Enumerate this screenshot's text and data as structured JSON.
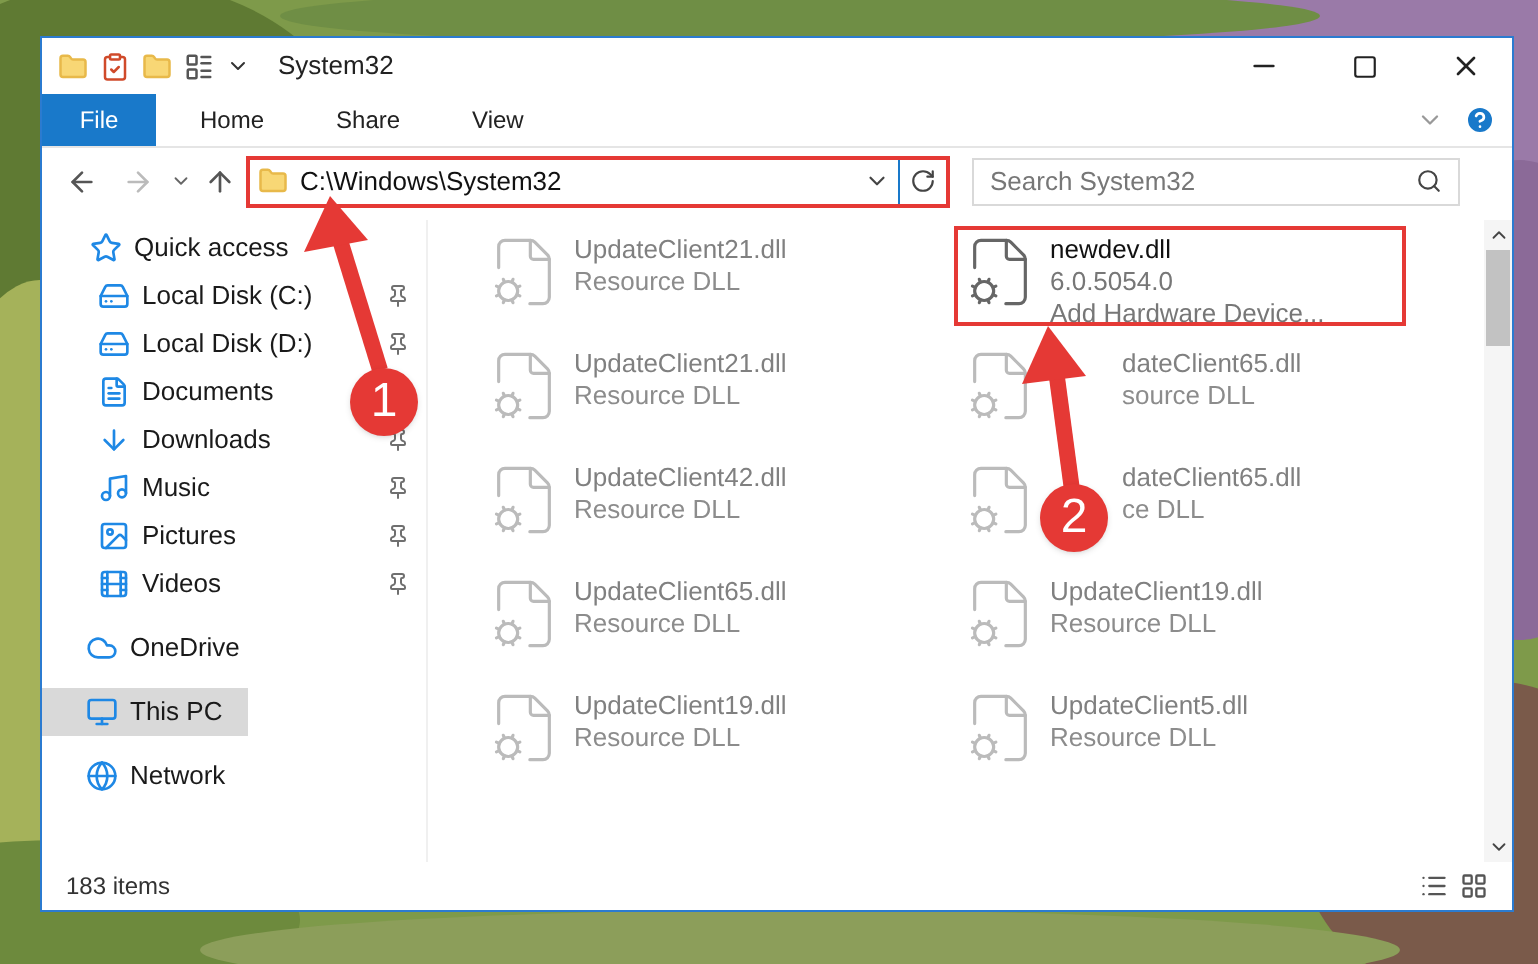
{
  "window": {
    "title": "System32"
  },
  "ribbon_tabs": [
    {
      "label": "File",
      "selected": true
    },
    {
      "label": "Home",
      "selected": false
    },
    {
      "label": "Share",
      "selected": false
    },
    {
      "label": "View",
      "selected": false
    }
  ],
  "address_bar": {
    "path": "C:\\Windows\\System32",
    "highlighted": true
  },
  "search": {
    "placeholder": "Search System32"
  },
  "sidebar": {
    "items": [
      {
        "label": "Quick access",
        "selected": false,
        "children": [
          {
            "label": "Local Disk (C:)",
            "pinned": true
          },
          {
            "label": "Local Disk (D:)",
            "pinned": true
          },
          {
            "label": "Documents",
            "pinned": false
          },
          {
            "label": "Downloads",
            "pinned": true
          },
          {
            "label": "Music",
            "pinned": true
          },
          {
            "label": "Pictures",
            "pinned": true
          },
          {
            "label": "Videos",
            "pinned": true
          }
        ]
      },
      {
        "label": "OneDrive",
        "selected": false
      },
      {
        "label": "This PC",
        "selected": true
      },
      {
        "label": "Network",
        "selected": false
      }
    ]
  },
  "files": [
    {
      "name": "UpdateClient21.dll",
      "details": [
        "Resource DLL"
      ],
      "blurred": true,
      "highlighted": false
    },
    {
      "name": "newdev.dll",
      "details": [
        "6.0.5054.0",
        "Add Hardware Device..."
      ],
      "blurred": false,
      "highlighted": true
    },
    {
      "name": "UpdateClient21.dll",
      "details": [
        "Resource DLL"
      ],
      "blurred": true,
      "highlighted": false
    },
    {
      "name": "dateClient65.dll",
      "details": [
        "source DLL"
      ],
      "blurred": true,
      "highlighted": false,
      "kind": "partly_hidden"
    },
    {
      "name": "UpdateClient42.dll",
      "details": [
        "Resource DLL"
      ],
      "blurred": true,
      "highlighted": false
    },
    {
      "name": "dateClient65.dll",
      "details": [
        "ce DLL"
      ],
      "blurred": true,
      "highlighted": false,
      "kind": "partly_hidden"
    },
    {
      "name": "UpdateClient65.dll",
      "details": [
        "Resource DLL"
      ],
      "blurred": true,
      "highlighted": false
    },
    {
      "name": "UpdateClient19.dll",
      "details": [
        "Resource DLL"
      ],
      "blurred": true,
      "highlighted": false
    },
    {
      "name": "UpdateClient19.dll",
      "details": [
        "Resource DLL"
      ],
      "blurred": true,
      "highlighted": false
    },
    {
      "name": "UpdateClient5.dll",
      "details": [
        "Resource DLL"
      ],
      "blurred": true,
      "highlighted": false
    }
  ],
  "status_bar": {
    "item_count": "183 items"
  },
  "annotations": [
    {
      "number": "1"
    },
    {
      "number": "2"
    }
  ]
}
